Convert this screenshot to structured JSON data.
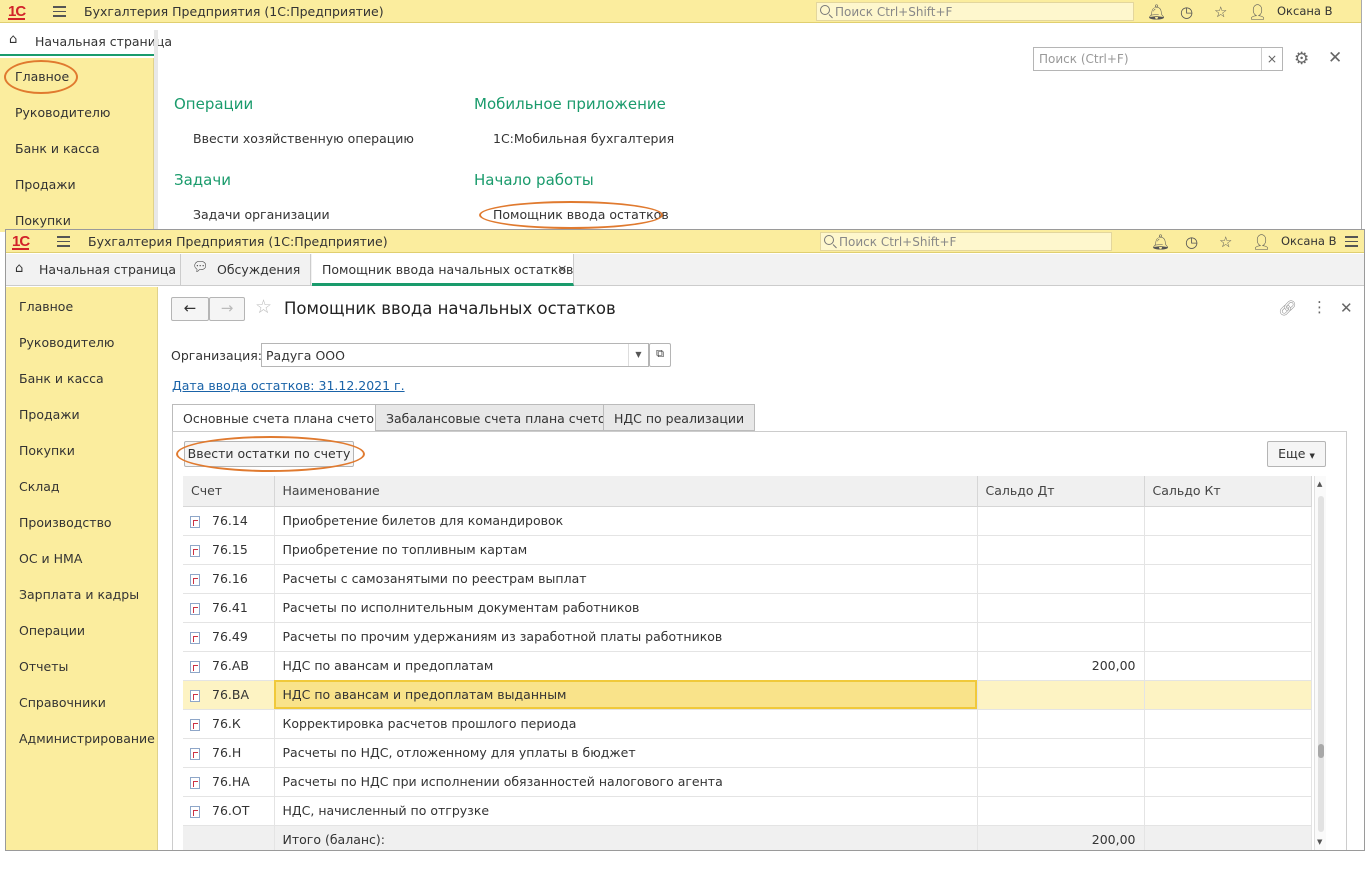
{
  "app": {
    "title": "Бухгалтерия Предприятия (1С:Предприятие)",
    "logo": "1С",
    "search_placeholder": "Поиск Ctrl+Shift+F",
    "user": "Оксана В"
  },
  "back": {
    "home_tab": "Начальная страница",
    "nav": [
      "Главное",
      "Руководителю",
      "Банк и касса",
      "Продажи",
      "Покупки"
    ],
    "search_placeholder": "Поиск (Ctrl+F)",
    "sections": {
      "operations": {
        "title": "Операции",
        "link": "Ввести хозяйственную операцию"
      },
      "mobile": {
        "title": "Мобильное приложение",
        "link": "1С:Мобильная бухгалтерия"
      },
      "tasks": {
        "title": "Задачи",
        "link": "Задачи организации"
      },
      "start": {
        "title": "Начало работы",
        "link": "Помощник ввода остатков"
      }
    }
  },
  "front": {
    "tabs": [
      "Начальная страница",
      "Обсуждения",
      "Помощник ввода начальных остатков"
    ],
    "nav": [
      "Главное",
      "Руководителю",
      "Банк и касса",
      "Продажи",
      "Покупки",
      "Склад",
      "Производство",
      "ОС и НМА",
      "Зарплата и кадры",
      "Операции",
      "Отчеты",
      "Справочники",
      "Администрирование"
    ],
    "form_title": "Помощник ввода начальных остатков",
    "org_label": "Организация:",
    "org_value": "Радуга ООО",
    "date_link": "Дата ввода остатков: 31.12.2021 г.",
    "subtabs": [
      "Основные счета плана счетов",
      "Забалансовые счета плана счетов",
      "НДС по реализации"
    ],
    "enter_button": "Ввести остатки по счету",
    "more_button": "Еще",
    "columns": [
      "Счет",
      "Наименование",
      "Сальдо Дт",
      "Сальдо Кт"
    ],
    "rows": [
      {
        "account": "76.14",
        "name": "Приобретение билетов для командировок",
        "dt": "",
        "kt": ""
      },
      {
        "account": "76.15",
        "name": "Приобретение по топливным картам",
        "dt": "",
        "kt": ""
      },
      {
        "account": "76.16",
        "name": "Расчеты с самозанятыми по реестрам выплат",
        "dt": "",
        "kt": ""
      },
      {
        "account": "76.41",
        "name": "Расчеты по исполнительным документам работников",
        "dt": "",
        "kt": ""
      },
      {
        "account": "76.49",
        "name": "Расчеты по прочим удержаниям из заработной платы работников",
        "dt": "",
        "kt": ""
      },
      {
        "account": "76.АВ",
        "name": "НДС по авансам и предоплатам",
        "dt": "200,00",
        "kt": ""
      },
      {
        "account": "76.ВА",
        "name": "НДС по авансам и предоплатам выданным",
        "dt": "",
        "kt": ""
      },
      {
        "account": "76.К",
        "name": "Корректировка расчетов прошлого периода",
        "dt": "",
        "kt": ""
      },
      {
        "account": "76.Н",
        "name": "Расчеты по НДС, отложенному для уплаты в бюджет",
        "dt": "",
        "kt": ""
      },
      {
        "account": "76.НА",
        "name": "Расчеты по НДС при исполнении обязанностей налогового агента",
        "dt": "",
        "kt": ""
      },
      {
        "account": "76.ОТ",
        "name": "НДС, начисленный по отгрузке",
        "dt": "",
        "kt": ""
      }
    ],
    "total": {
      "label": "Итого (баланс):",
      "dt": "200,00",
      "kt": ""
    }
  }
}
